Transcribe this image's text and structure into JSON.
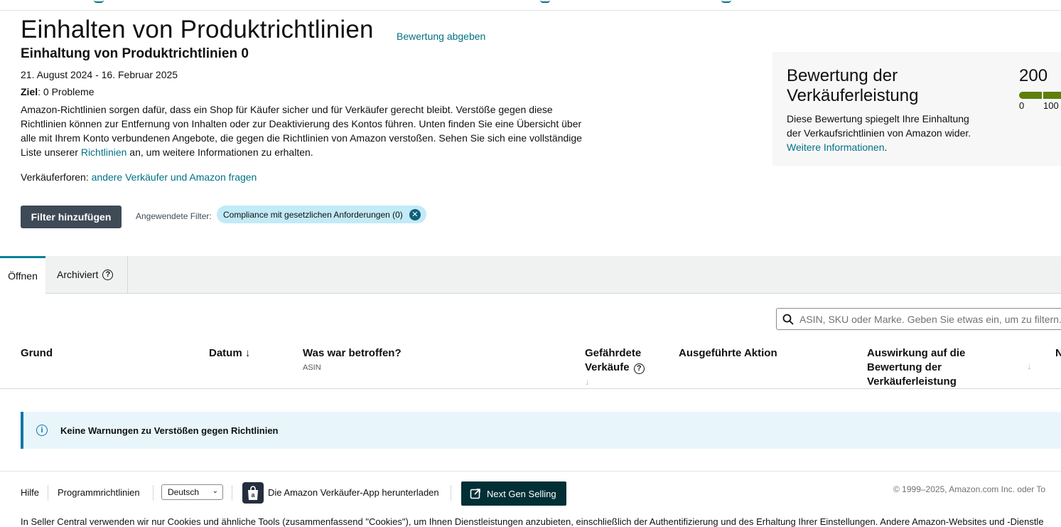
{
  "header": {
    "title": "Einhalten von Produktrichtlinien",
    "rate_link": "Bewertung abgeben",
    "subtitle": "Einhaltung von Produktrichtlinien 0",
    "date_range": "21. August 2024 - 16. Februar 2025",
    "goal_label": "Ziel",
    "goal_value": ": 0 Probleme",
    "description_1": "Amazon-Richtlinien sorgen dafür, dass ein Shop für Käufer sicher und für Verkäufer gerecht bleibt. Verstöße gegen diese Richtlinien können zur Entfernung von Inhalten oder zur Deaktivierung des Kontos führen. Unten finden Sie eine Übersicht über alle mit Ihrem Konto verbundenen Angebote, die gegen die Richtlinien von Amazon verstoßen. Sehen Sie sich eine vollständige Liste unserer ",
    "description_link": "Richtlinien",
    "description_2": " an, um weitere Informationen zu erhalten.",
    "forums_label": "Verkäuferforen: ",
    "forums_link": "andere Verkäufer und Amazon fragen"
  },
  "filters": {
    "add_button": "Filter hinzufügen",
    "applied_label": "Angewendete Filter:",
    "chips": [
      "Compliance mit gesetzlichen Anforderungen (0)"
    ]
  },
  "score_card": {
    "title": "Bewertung der Verkäuferleistung",
    "text_1": "Diese Bewertung spiegelt Ihre Einhaltung der Verkaufsrichtlinien von Amazon wider. ",
    "link": "Weitere Informationen",
    "text_2": ".",
    "value": "200",
    "min_label": "0",
    "max_label": "100",
    "bar_color": "#5e7f0a"
  },
  "tabs": {
    "open": "Öffnen",
    "archived": "Archiviert"
  },
  "search": {
    "placeholder": "ASIN, SKU oder Marke. Geben Sie etwas ein, um zu filtern..."
  },
  "table": {
    "columns": {
      "reason": "Grund",
      "date": "Datum",
      "date_sort": "↓",
      "affected": "Was war betroffen?",
      "affected_sub": "ASIN",
      "sales_at_risk": "Gefährdete Verkäufe",
      "action": "Ausgeführte Aktion",
      "impact": "Auswirkung auf die Bewertung der Verkäuferleistung",
      "next": "N"
    },
    "empty_message": "Keine Warnungen zu Verstößen gegen Richtlinien"
  },
  "footer": {
    "help": "Hilfe",
    "policies": "Programmrichtlinien",
    "language": "Deutsch",
    "app_link": "Die Amazon Verkäufer-App herunterladen",
    "ngs_button": "Next Gen Selling",
    "copyright": "© 1999–2025, Amazon.com Inc. oder To",
    "cookie_notice": "In Seller Central verwenden wir nur Cookies und ähnliche Tools (zusammenfassend \"Cookies\"), um Ihnen Dienstleistungen anzubieten, einschließlich der Authentifizierung und des Erhaltung Ihrer Einstellungen. Andere Amazon-Websites und -Dienstle"
  },
  "colors": {
    "link": "#007185",
    "tab_accent": "#008296",
    "button_dark": "#3f4a57",
    "chip_bg": "#c2eaf7",
    "alert_bg": "#e8f6fc",
    "alert_border": "#0e76a8",
    "ngs_bg": "#002f36"
  }
}
